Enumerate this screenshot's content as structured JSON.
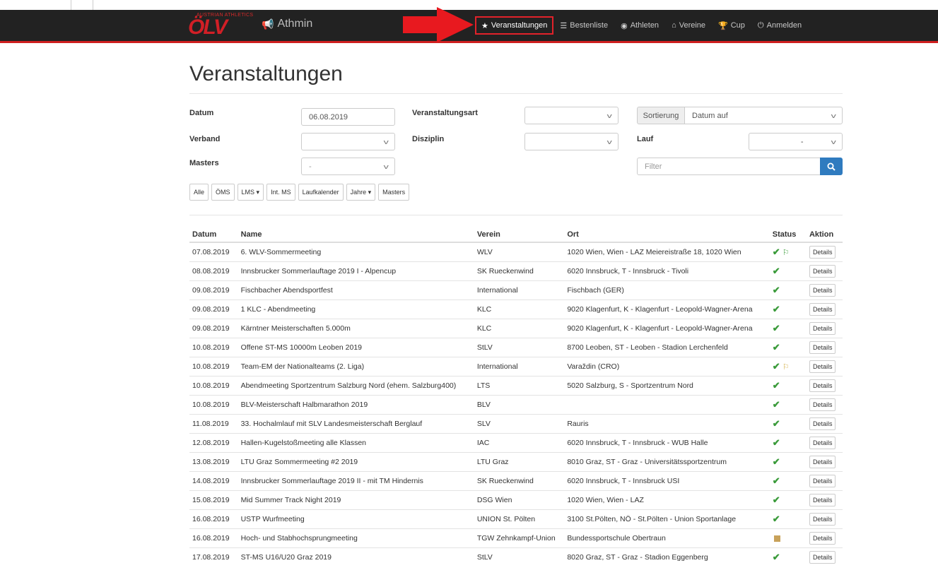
{
  "app": {
    "logo_small_text": "AUSTRIAN ATHLETICS",
    "logo_text": "ÖLV",
    "brand": "Athmin",
    "colors": {
      "navbar": "#222222",
      "accent_red": "#cf1f1f",
      "search_btn": "#2f7bbf",
      "ok_green": "#3a9b3a"
    }
  },
  "nav": {
    "items": [
      {
        "icon": "star-icon",
        "label": "Veranstaltungen",
        "active": true
      },
      {
        "icon": "list-icon",
        "label": "Bestenliste"
      },
      {
        "icon": "user-circle-icon",
        "label": "Athleten"
      },
      {
        "icon": "home-icon",
        "label": "Vereine"
      },
      {
        "icon": "trophy-icon",
        "label": "Cup"
      },
      {
        "icon": "power-icon",
        "label": "Anmelden"
      }
    ]
  },
  "page": {
    "title": "Veranstaltungen"
  },
  "filters": {
    "datum_label": "Datum",
    "datum_value": "06.08.2019",
    "veranstaltungsart_label": "Veranstaltungsart",
    "veranstaltungsart_value": "",
    "sortierung_label": "Sortierung",
    "sortierung_value": "Datum auf",
    "verband_label": "Verband",
    "verband_value": "",
    "disziplin_label": "Disziplin",
    "disziplin_value": "",
    "lauf_label": "Lauf",
    "lauf_value": "-",
    "masters_label": "Masters",
    "masters_value": "-",
    "filter_placeholder": "Filter"
  },
  "quick_buttons": {
    "alle": "Alle",
    "oems": "ÖMS",
    "lms": "LMS ▾",
    "intms": "Int. MS",
    "laufkalender": "Laufkalender",
    "jahre": "Jahre ▾",
    "masters": "Masters"
  },
  "table": {
    "headers": {
      "datum": "Datum",
      "name": "Name",
      "verein": "Verein",
      "ort": "Ort",
      "status": "Status",
      "aktion": "Aktion"
    },
    "details_label": "Details",
    "rows": [
      {
        "datum": "07.08.2019",
        "name": "6. WLV-Sommermeeting",
        "verein": "WLV",
        "ort": "1020 Wien, Wien - LAZ Meiereistraße 18, 1020 Wien",
        "status": "check-green-flag"
      },
      {
        "datum": "08.08.2019",
        "name": "Innsbrucker Sommerlauftage 2019 I - Alpencup",
        "verein": "SK Rueckenwind",
        "ort": "6020 Innsbruck, T - Innsbruck - Tivoli",
        "status": "check"
      },
      {
        "datum": "09.08.2019",
        "name": "Fischbacher Abendsportfest",
        "verein": "International",
        "ort": "Fischbach (GER)",
        "status": "check"
      },
      {
        "datum": "09.08.2019",
        "name": "1 KLC - Abendmeeting",
        "verein": "KLC",
        "ort": "9020 Klagenfurt, K - Klagenfurt - Leopold-Wagner-Arena",
        "status": "check"
      },
      {
        "datum": "09.08.2019",
        "name": "Kärntner Meisterschaften 5.000m",
        "verein": "KLC",
        "ort": "9020 Klagenfurt, K - Klagenfurt - Leopold-Wagner-Arena",
        "status": "check"
      },
      {
        "datum": "10.08.2019",
        "name": "Offene ST-MS 10000m Leoben 2019",
        "verein": "StLV",
        "ort": "8700 Leoben, ST - Leoben - Stadion Lerchenfeld",
        "status": "check"
      },
      {
        "datum": "10.08.2019",
        "name": "Team-EM der Nationalteams (2. Liga)",
        "verein": "International",
        "ort": "Varaždin (CRO)",
        "status": "check-yellow-flag"
      },
      {
        "datum": "10.08.2019",
        "name": "Abendmeeting Sportzentrum Salzburg Nord (ehem. Salzburg400)",
        "verein": "LTS",
        "ort": "5020 Salzburg, S - Sportzentrum Nord",
        "status": "check"
      },
      {
        "datum": "10.08.2019",
        "name": "BLV-Meisterschaft Halbmarathon 2019",
        "verein": "BLV",
        "ort": "",
        "status": "check"
      },
      {
        "datum": "11.08.2019",
        "name": "33. Hochalmlauf mit SLV Landesmeisterschaft Berglauf",
        "verein": "SLV",
        "ort": "Rauris",
        "status": "check"
      },
      {
        "datum": "12.08.2019",
        "name": "Hallen-Kugelstoßmeeting alle Klassen",
        "verein": "IAC",
        "ort": "6020 Innsbruck, T - Innsbruck - WUB Halle",
        "status": "check"
      },
      {
        "datum": "13.08.2019",
        "name": "LTU Graz Sommermeeting #2 2019",
        "verein": "LTU Graz",
        "ort": "8010 Graz, ST - Graz - Universitätssportzentrum",
        "status": "check"
      },
      {
        "datum": "14.08.2019",
        "name": "Innsbrucker Sommerlauftage 2019 II - mit TM Hindernis",
        "verein": "SK Rueckenwind",
        "ort": "6020 Innsbruck, T - Innsbruck USI",
        "status": "check"
      },
      {
        "datum": "15.08.2019",
        "name": "Mid Summer Track Night 2019",
        "verein": "DSG Wien",
        "ort": "1020 Wien, Wien - LAZ",
        "status": "check"
      },
      {
        "datum": "16.08.2019",
        "name": "USTP Wurfmeeting",
        "verein": "UNION St. Pölten",
        "ort": "3100 St.Pölten, NÖ - St.Pölten - Union Sportanlage",
        "status": "check"
      },
      {
        "datum": "16.08.2019",
        "name": "Hoch- und Stabhochsprungmeeting",
        "verein": "TGW Zehnkampf-Union",
        "ort": "Bundessportschule Obertraun",
        "status": "square"
      },
      {
        "datum": "17.08.2019",
        "name": "ST-MS U16/U20 Graz 2019",
        "verein": "StLV",
        "ort": "8020 Graz, ST - Graz - Stadion Eggenberg",
        "status": "check"
      }
    ]
  }
}
